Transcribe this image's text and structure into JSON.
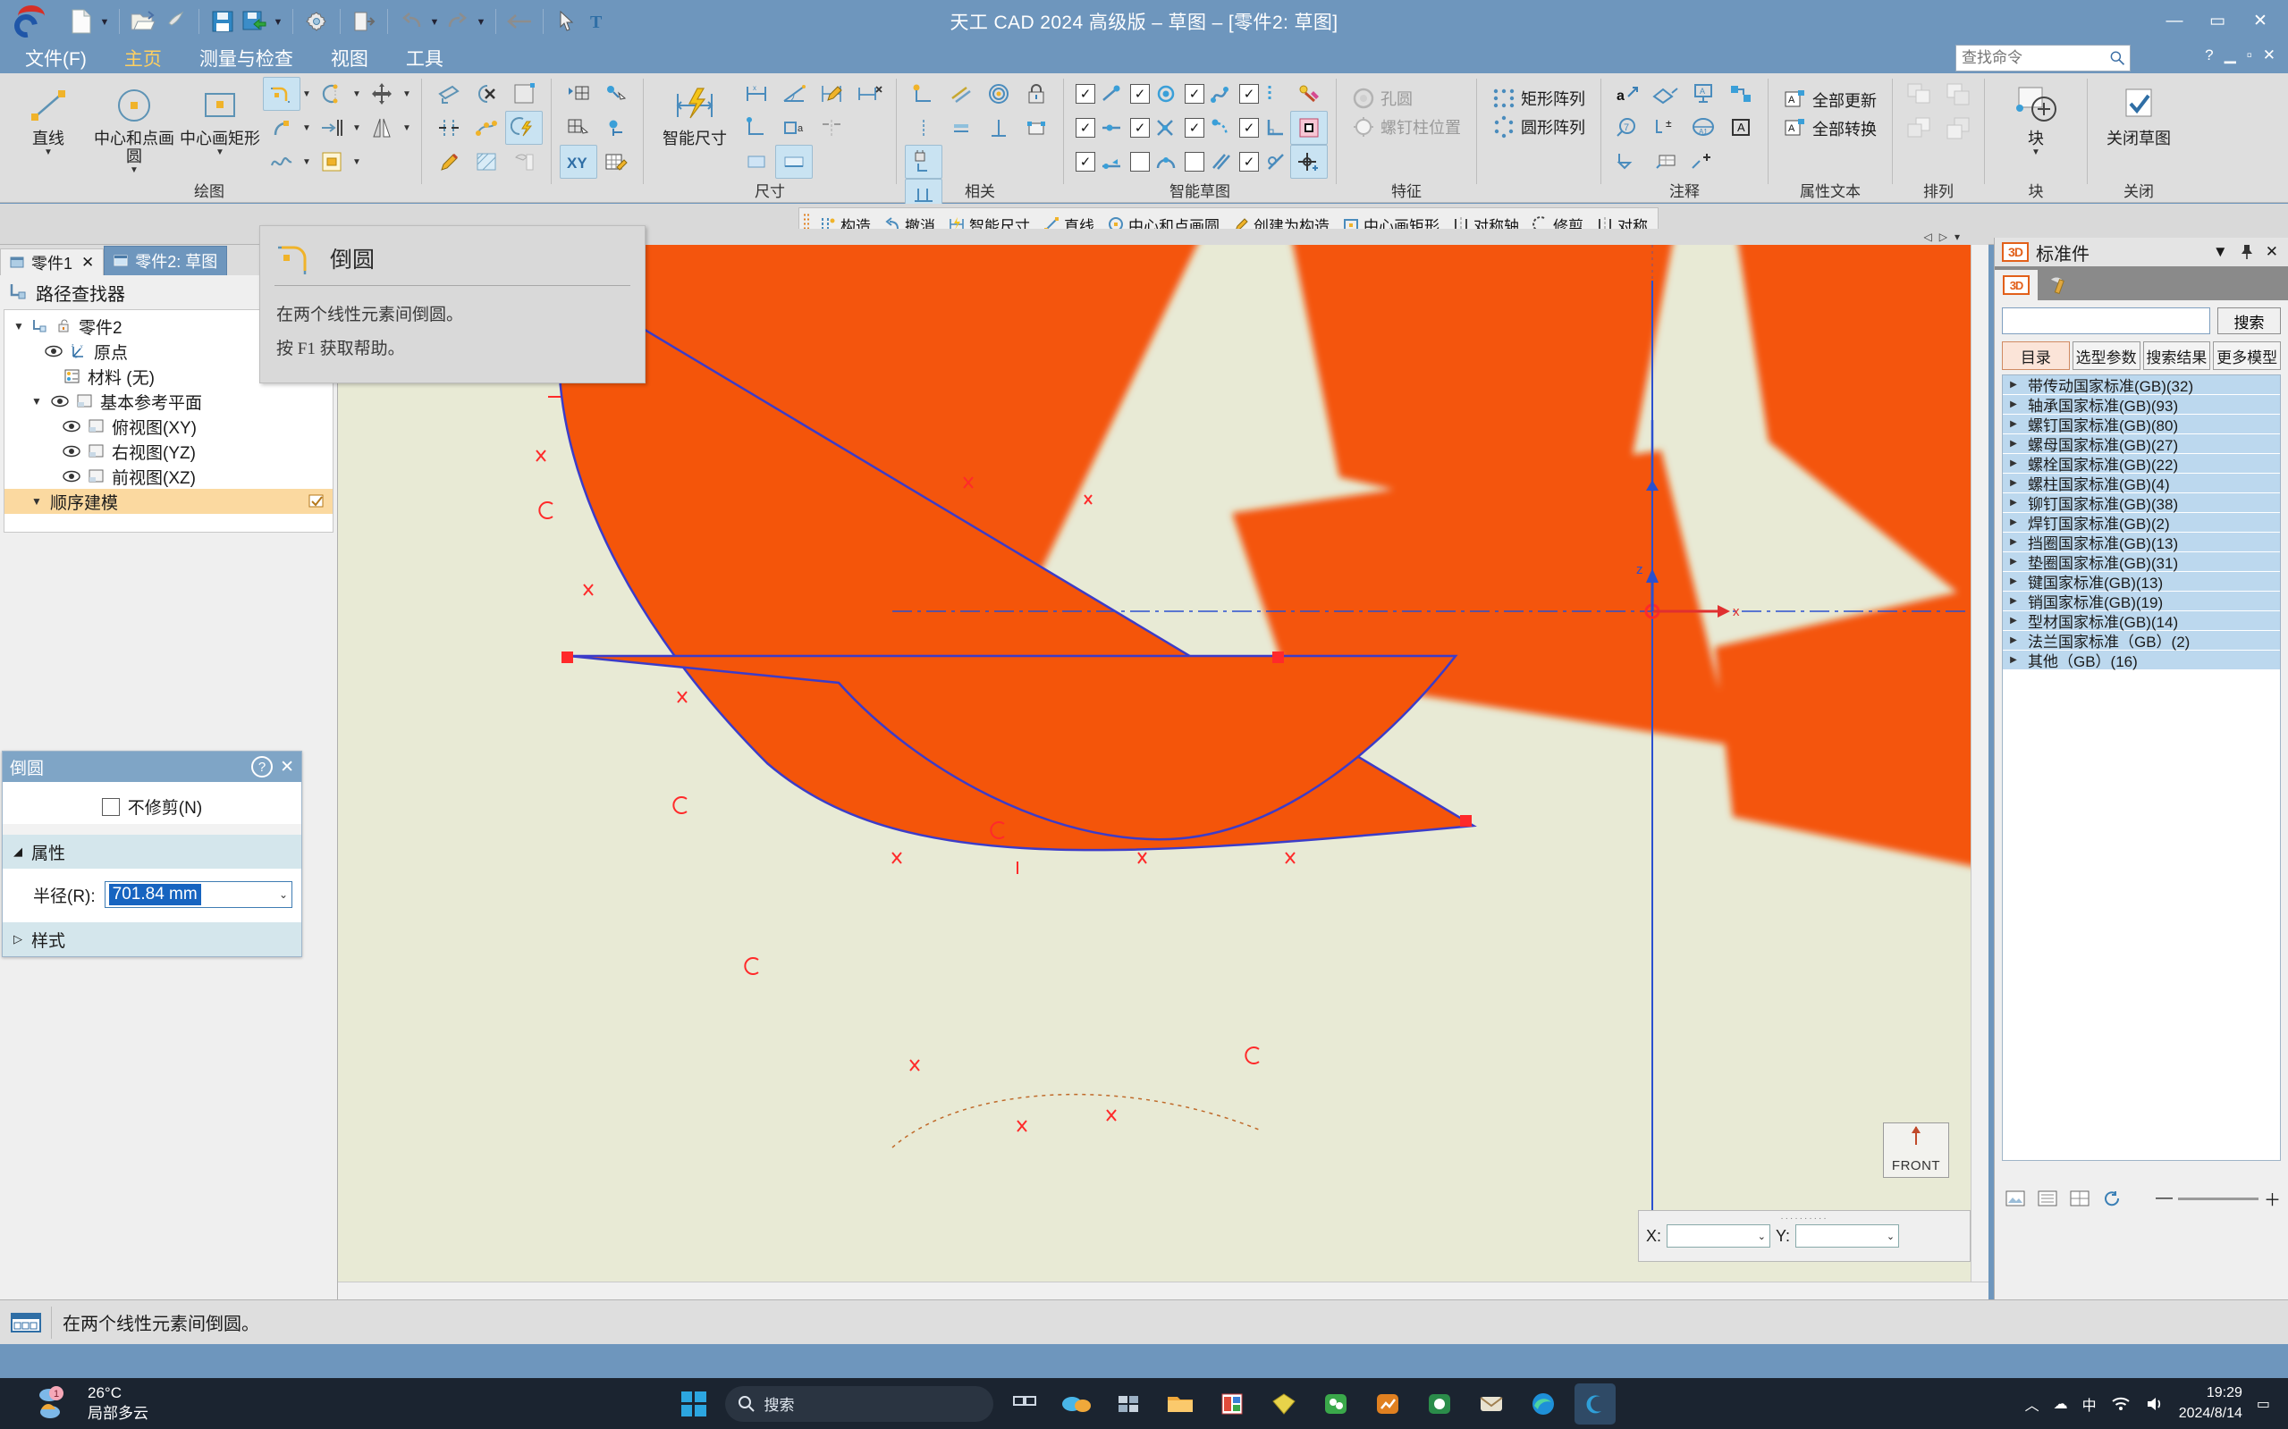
{
  "window": {
    "title": "天工 CAD 2024 高级版 – 草图 – [零件2: 草图]",
    "minimize": "—",
    "maximize": "▭",
    "close": "✕"
  },
  "quick_access": {
    "new_label": "new-file",
    "open_label": "open-file",
    "print_label": "print",
    "save_label": "save",
    "save_as_label": "save-as",
    "settings_label": "settings",
    "exit_label": "exit",
    "undo_label": "undo",
    "redo_label": "redo",
    "back_label": "back",
    "select_label": "select",
    "text_label": "text"
  },
  "menu": {
    "items": [
      {
        "label": "文件(F)",
        "active": false
      },
      {
        "label": "主页",
        "active": true
      },
      {
        "label": "测量与检查",
        "active": false
      },
      {
        "label": "视图",
        "active": false
      },
      {
        "label": "工具",
        "active": false
      }
    ],
    "find_placeholder": "查找命令",
    "help": "?",
    "min": "▁",
    "max": "▫",
    "close": "✕"
  },
  "ribbon": {
    "groups": [
      {
        "label": "绘图",
        "big_buttons": [
          {
            "label": "直线",
            "icon": "line-icon",
            "dropdown": "▼"
          },
          {
            "label": "中心和点画圆",
            "icon": "circle-center-point-icon",
            "dropdown": "▼"
          },
          {
            "label": "中心画矩形",
            "icon": "rectangle-center-icon",
            "dropdown": "▼"
          }
        ],
        "small_items": [
          "fillet-icon",
          "arc-icon",
          "move-icon",
          "curve-icon",
          "offset-icon",
          "mirror-icon",
          "spline-icon",
          "region-icon"
        ]
      },
      {
        "label": "",
        "small_items": [
          "select-tool-icon",
          "delete-relationship-icon",
          "fill-icon",
          "stretch-icon",
          "edit-curve-icon",
          "smart-dim-highlight-icon",
          "draw-edit-icon",
          "hatch-icon",
          "hammer-icon"
        ]
      },
      {
        "label": "",
        "small_items": [
          "grid-start-icon",
          "attach-point-icon",
          "grid-select-icon",
          "point-axis-icon",
          "xy-icon",
          "matrix-edit-icon"
        ]
      },
      {
        "label": "尺寸",
        "big_buttons": [
          {
            "label": "智能尺寸",
            "icon": "smart-dimension-icon",
            "dropdown": ""
          }
        ],
        "small_items": [
          "distance-dim-icon",
          "angle-dim-icon",
          "edit-dim-icon",
          "remove-dim-icon",
          "coordinate-dim-icon",
          "area-dim-icon",
          "symmetric-dim-icon"
        ]
      },
      {
        "label": "相关",
        "small_items": [
          "connect-icon",
          "concentric-icon",
          "horizontal-vertical-icon",
          "lock-icon",
          "tangent-icon",
          "equal-icon",
          "perpendicular-icon",
          "rigid-set-icon",
          "dim-lock-icon",
          "parallel-lock-icon"
        ]
      },
      {
        "label": "智能草图",
        "checkboxes": [
          {
            "label": "point-relation",
            "checked": true
          },
          {
            "label": "center-relation",
            "checked": true
          },
          {
            "label": "curve-relation",
            "checked": true
          },
          {
            "label": "vertical-relation",
            "checked": true
          },
          {
            "label": "midpoint-relation",
            "checked": true
          },
          {
            "label": "intersection-relation",
            "checked": true
          },
          {
            "label": "tangent-relation",
            "checked": true
          },
          {
            "label": "perpendicular-relation",
            "checked": true
          },
          {
            "label": "endpoint-relation",
            "checked": true
          },
          {
            "label": "arc-relation",
            "checked": false
          },
          {
            "label": "parallel-relation",
            "checked": false
          },
          {
            "label": "angle-relation",
            "checked": true
          }
        ],
        "extra_icons": [
          "smart-sketch-pen-icon",
          "grid-snap-icon",
          "point-snap-icon"
        ]
      },
      {
        "label": "特征",
        "label_buttons": [
          {
            "label": "孔圆",
            "icon": "hole-circle-icon",
            "disabled": true
          },
          {
            "label": "螺钉柱位置",
            "icon": "screw-boss-icon",
            "disabled": true
          }
        ]
      },
      {
        "label": "",
        "label_buttons": [
          {
            "label": "矩形阵列",
            "icon": "rect-pattern-icon",
            "disabled": false
          },
          {
            "label": "圆形阵列",
            "icon": "circular-pattern-icon",
            "disabled": false
          }
        ]
      },
      {
        "label": "注释",
        "small_items": [
          "leader-icon",
          "balloon-icon",
          "callout-icon",
          "connector-icon",
          "feature-callout-icon",
          "tolerance-icon",
          "surface-finish-icon",
          "text-box-icon",
          "datum-frame-icon",
          "table-icon",
          "weld-symbol-icon"
        ]
      },
      {
        "label": "属性文本",
        "label_buttons": [
          {
            "label": "全部更新",
            "icon": "update-all-icon",
            "disabled": false
          },
          {
            "label": "全部转换",
            "icon": "convert-all-icon",
            "disabled": false
          }
        ]
      },
      {
        "label": "排列",
        "small_items": [
          "bring-forward-icon",
          "send-backward-icon",
          "bring-front-icon",
          "send-back-icon"
        ]
      },
      {
        "label": "块",
        "big_buttons": [
          {
            "label": "块",
            "icon": "block-add-icon",
            "dropdown": "▼"
          }
        ]
      },
      {
        "label": "关闭",
        "big_buttons": [
          {
            "label": "关闭草图",
            "icon": "close-sketch-icon",
            "dropdown": ""
          }
        ]
      }
    ]
  },
  "command_bar": {
    "items": [
      {
        "label": "构造",
        "icon": "construction-icon"
      },
      {
        "label": "撤消",
        "icon": "undo-icon"
      },
      {
        "label": "智能尺寸",
        "icon": "smart-dimension-icon"
      },
      {
        "label": "直线",
        "icon": "line-icon"
      },
      {
        "label": "中心和点画圆",
        "icon": "circle-icon"
      },
      {
        "label": "创建为构造",
        "icon": "create-construction-icon"
      },
      {
        "label": "中心画矩形",
        "icon": "rectangle-icon"
      },
      {
        "label": "对称轴",
        "icon": "symmetry-axis-icon"
      },
      {
        "label": "修剪",
        "icon": "trim-icon"
      },
      {
        "label": "对称",
        "icon": "symmetry-icon"
      }
    ]
  },
  "left_panel": {
    "doc_tabs": [
      {
        "label": "零件1",
        "active": false,
        "close": "✕"
      },
      {
        "label": "零件2: 草图",
        "active": true,
        "close": ""
      }
    ],
    "pathfinder_title": "路径查找器",
    "tree": [
      {
        "label": "零件2",
        "depth": 0,
        "arrow": "▼",
        "eye": false,
        "icon": "part-icon",
        "hl": false
      },
      {
        "label": "原点",
        "depth": 1,
        "arrow": "",
        "eye": true,
        "icon": "origin-icon",
        "hl": false
      },
      {
        "label": "材料 (无)",
        "depth": 1,
        "arrow": "",
        "eye": false,
        "icon": "material-icon",
        "hl": false
      },
      {
        "label": "基本参考平面",
        "depth": 1,
        "arrow": "▼",
        "eye": true,
        "icon": "plane-icon",
        "hl": false
      },
      {
        "label": "俯视图(XY)",
        "depth": 2,
        "arrow": "",
        "eye": true,
        "icon": "plane-icon",
        "hl": false
      },
      {
        "label": "右视图(YZ)",
        "depth": 2,
        "arrow": "",
        "eye": true,
        "icon": "plane-icon",
        "hl": false
      },
      {
        "label": "前视图(XZ)",
        "depth": 2,
        "arrow": "",
        "eye": true,
        "icon": "plane-icon",
        "hl": false
      },
      {
        "label": "顺序建模",
        "depth": 1,
        "arrow": "▼",
        "eye": false,
        "icon": "",
        "hl": true
      }
    ]
  },
  "dialog": {
    "title": "倒圆",
    "help": "?",
    "close": "✕",
    "no_trim_label": "不修剪(N)",
    "no_trim_checked": false,
    "properties_section": "属性",
    "properties_arrow": "◢",
    "radius_label": "半径(R):",
    "radius_value": "701.84 mm",
    "style_section": "样式",
    "style_arrow": "▷"
  },
  "tooltip": {
    "title": "倒圆",
    "description": "在两个线性元素间倒圆。",
    "help_line": "按 F1 获取帮助。"
  },
  "canvas": {
    "nav_left": "◁",
    "nav_right": "▷",
    "nav_down": "▾",
    "view_cube_label": "FRONT",
    "coord": {
      "x_label": "X:",
      "y_label": "Y:",
      "x_value": "",
      "y_value": "",
      "dots": "··········"
    }
  },
  "right_panel": {
    "title": "标准件",
    "badge": "3D",
    "collapse": "▼",
    "pin": "📌",
    "close": "✕",
    "tabs": [
      {
        "icon": "3d-badge-icon",
        "active": true
      },
      {
        "icon": "hammer-icon",
        "active": false
      }
    ],
    "search_value": "",
    "search_button": "搜索",
    "bottom_tabs": [
      {
        "label": "目录",
        "active": true
      },
      {
        "label": "选型参数",
        "active": false
      },
      {
        "label": "搜索结果",
        "active": false
      },
      {
        "label": "更多模型",
        "active": false
      }
    ],
    "categories": [
      "带传动国家标准(GB)(32)",
      "轴承国家标准(GB)(93)",
      "螺钉国家标准(GB)(80)",
      "螺母国家标准(GB)(27)",
      "螺栓国家标准(GB)(22)",
      "螺柱国家标准(GB)(4)",
      "铆钉国家标准(GB)(38)",
      "焊钉国家标准(GB)(2)",
      "挡圈国家标准(GB)(13)",
      "垫圈国家标准(GB)(31)",
      "键国家标准(GB)(13)",
      "销国家标准(GB)(19)",
      "型材国家标准(GB)(14)",
      "法兰国家标准（GB）(2)",
      "其他（GB）(16)"
    ]
  },
  "status_bar": {
    "message": "在两个线性元素间倒圆。",
    "icon": "status-panel-icon"
  },
  "taskbar": {
    "weather": {
      "temp": "26°C",
      "condition": "局部多云",
      "badge": "1"
    },
    "search_placeholder": "搜索",
    "search_icon": "search-icon",
    "start_icon": "windows-start-icon",
    "apps": [
      "task-view-icon",
      "copilot-icon",
      "widgets-icon",
      "file-explorer-icon",
      "office-icon",
      "cad-yellow-icon",
      "wechat-icon",
      "chart-icon",
      "wechat-work-icon",
      "mail-icon",
      "edge-icon",
      "cad-app-icon"
    ],
    "tray": {
      "chevron": "︿",
      "cloud": "☁",
      "lang": "中",
      "wifi": "wifi-icon",
      "volume": "volume-icon",
      "time": "19:29",
      "date": "2024/8/14",
      "notify": "▭"
    }
  },
  "colors": {
    "titlebar": "#6e96bd",
    "accent_orange": "#ffd060",
    "ribbon_bg": "#dedede",
    "canvas_bg": "#e8ead5",
    "shape_fill": "#f4550a",
    "selected_blue": "#1764c0",
    "category_row": "#bcd8ee"
  }
}
